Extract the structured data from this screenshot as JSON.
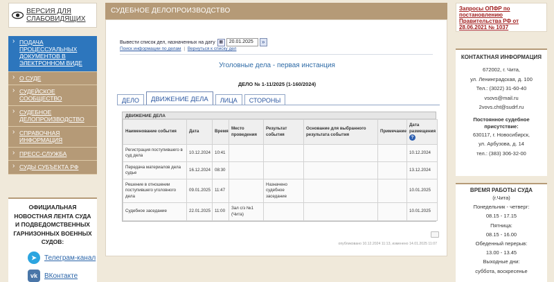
{
  "header": {
    "vision_link": "ВЕРСИЯ ДЛЯ СЛАБОВИДЯЩИХ",
    "section_title": "СУДЕБНОЕ ДЕЛОПРОИЗВОДСТВО",
    "opfr_link": "Запросы ОПФР по постановлению Правительства РФ от 28.06.2021 № 1037"
  },
  "menu": [
    {
      "label": "ПОДАЧА ПРОЦЕССУАЛЬНЫХ ДОКУМЕНТОВ В ЭЛЕКТРОННОМ ВИДЕ"
    },
    {
      "label": "О СУДЕ"
    },
    {
      "label": "СУДЕЙСКОЕ СООБЩЕСТВО"
    },
    {
      "label": "СУДЕБНОЕ ДЕЛОПРОИЗВОДСТВО"
    },
    {
      "label": "СПРАВОЧНАЯ ИНФОРМАЦИЯ"
    },
    {
      "label": "ПРЕСС-СЛУЖБА"
    },
    {
      "label": "СУДЫ СУБЪЕКТА РФ"
    }
  ],
  "news": {
    "title": "ОФИЦИАЛЬНАЯ НОВОСТНАЯ ЛЕНТА СУДА И ПОДВЕДОМСТВЕННЫХ ГАРНИЗОННЫХ ВОЕННЫХ СУДОВ:",
    "telegram": "Телеграм-канал",
    "vk": "ВКонтакте"
  },
  "filter": {
    "label": "Вывести список дел, назначенных на дату",
    "date": "20.01.2025",
    "search_link": "Поиск информации по делам",
    "separator": "|",
    "back_link": "Вернуться к списку дел"
  },
  "instance_title": "Уголовные дела - первая инстанция",
  "case_title": "ДЕЛО № 1-11/2025 (1-160/2024)",
  "tabs": [
    {
      "label": "ДЕЛО"
    },
    {
      "label": "ДВИЖЕНИЕ ДЕЛА"
    },
    {
      "label": "ЛИЦА"
    },
    {
      "label": "СТОРОНЫ"
    }
  ],
  "grid": {
    "title": "ДВИЖЕНИЕ ДЕЛА",
    "columns": [
      "Наименование события",
      "Дата",
      "Время",
      "Место проведения",
      "Результат события",
      "Основание для выбранного результата события",
      "Примечание",
      "Дата размещения"
    ],
    "help_icon": "?",
    "rows": [
      {
        "event": "Регистрация поступившего в суд дела",
        "date": "10.12.2024",
        "time": "10:41",
        "place": "",
        "result": "",
        "basis": "",
        "note": "",
        "posted": "10.12.2024"
      },
      {
        "event": "Передача материалов дела судье",
        "date": "16.12.2024",
        "time": "08:30",
        "place": "",
        "result": "",
        "basis": "",
        "note": "",
        "posted": "13.12.2024"
      },
      {
        "event": "Решение в отношении поступившего уголовного дела",
        "date": "09.01.2025",
        "time": "11:47",
        "place": "",
        "result": "Назначено судебное заседание",
        "basis": "",
        "note": "",
        "posted": "10.01.2025"
      },
      {
        "event": "Судебное заседание",
        "date": "22.01.2025",
        "time": "11:00",
        "place": "Зал с/з №1 (Чита)",
        "result": "",
        "basis": "",
        "note": "",
        "posted": "10.01.2025"
      }
    ]
  },
  "pub_info": "опубликовано 10.12.2024 11:13, изменено 14.01.2025 11:07",
  "contacts": {
    "title": "КОНТАКТНАЯ ИНФОРМАЦИЯ",
    "line1": "672002, г. Чита,",
    "line2": "ул. Ленинградская, д. 100",
    "line3": "Тел.: (3022) 31-60-40",
    "line4": "vsovs@mail.ru",
    "line5": "2vovs.cht@sudrf.ru",
    "presence_title": "Постоянное судебное присутствие:",
    "p_line1": "630117, г. Новосибирск,",
    "p_line2": "ул. Арбузова, д. 14",
    "p_line3": "тел.: (383) 306-32-00"
  },
  "hours": {
    "title": "ВРЕМЯ РАБОТЫ СУДА",
    "city": "(г.Чита)",
    "l1": "Понедельник - четверг:",
    "l2": "08.15 - 17.15",
    "l3": "Пятница:",
    "l4": "08.15 - 16.00",
    "l5": "Обеденный перерыв:",
    "l6": "13.00 - 13.45",
    "l7": "Выходные дни:",
    "l8": "суббота, воскресенье"
  },
  "colors": {
    "accent": "#b59a77",
    "active_menu": "#2d76bd",
    "background": "#f0e9da",
    "link": "#2a56a0",
    "alert": "#a01c1c"
  }
}
